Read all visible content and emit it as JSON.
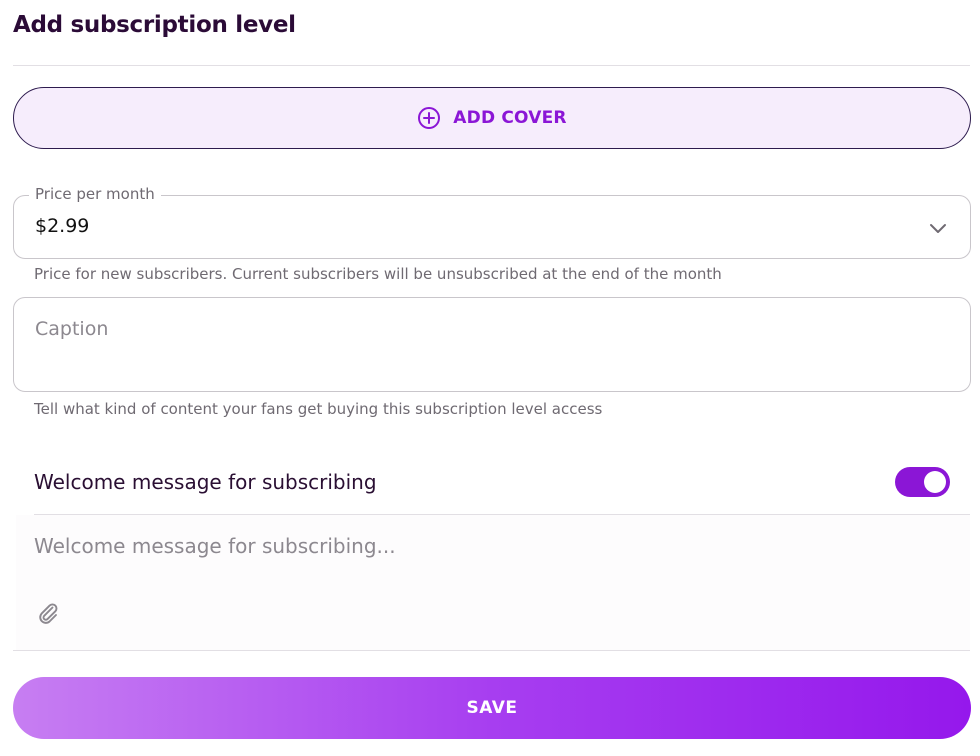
{
  "header": {
    "title": "Add subscription level"
  },
  "cover": {
    "label": "ADD COVER",
    "icon": "plus-circle-icon",
    "accent": "#8b16d6"
  },
  "price": {
    "label": "Price per month",
    "value": "$2.99",
    "helper": "Price for new subscribers. Current subscribers will be unsubscribed at the end of the month"
  },
  "caption": {
    "placeholder": "Caption",
    "helper": "Tell what kind of content your fans get buying this subscription level access"
  },
  "welcome": {
    "label": "Welcome message for subscribing",
    "toggle_on": true,
    "placeholder": "Welcome message for subscribing...",
    "attach_icon": "paperclip-icon"
  },
  "actions": {
    "save_label": "SAVE"
  }
}
